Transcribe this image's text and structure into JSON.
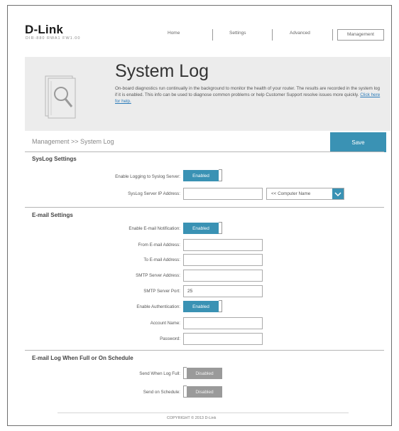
{
  "brand": {
    "logo": "D-Link",
    "model": "DIR-880 RWA1 FW1.00"
  },
  "nav": {
    "home": "Home",
    "settings": "Settings",
    "advanced": "Advanced",
    "management": "Management"
  },
  "banner": {
    "title": "System Log",
    "description": "On-board diagnostics run continually in the background to monitor the health of your router. The results are recorded in the system log if it is enabled. This info can be used to diagnose common problems or help Customer Support resolve issues more quickly.",
    "link": "Click here for help."
  },
  "breadcrumb": "Management >> System Log",
  "save_label": "Save",
  "syslog": {
    "title": "SysLog Settings",
    "enable_label": "Enable Logging to Syslog Server:",
    "enable_state": "Enabled",
    "server_ip_label": "SysLog Server IP Address:",
    "server_ip_value": "",
    "computer_select": "<< Computer Name"
  },
  "email": {
    "title": "E-mail Settings",
    "enable_label": "Enable E-mail Notification:",
    "enable_state": "Enabled",
    "from_label": "From E-mail Address:",
    "to_label": "To E-mail Address:",
    "smtp_label": "SMTP Server Address:",
    "port_label": "SMTP Server Port:",
    "port_value": "25",
    "auth_label": "Enable Authentication:",
    "auth_state": "Enabled",
    "account_label": "Account Name:",
    "password_label": "Password:"
  },
  "schedule": {
    "title": "E-mail Log When Full or On Schedule",
    "full_label": "Send When Log Full:",
    "full_state": "Disabled",
    "sched_label": "Send on Schedule:",
    "sched_state": "Disabled"
  },
  "footer": "COPYRIGHT © 2013 D-Link",
  "colors": {
    "accent": "#3a92b4",
    "disabled": "#9a9a9a",
    "banner_bg": "#ececec"
  }
}
